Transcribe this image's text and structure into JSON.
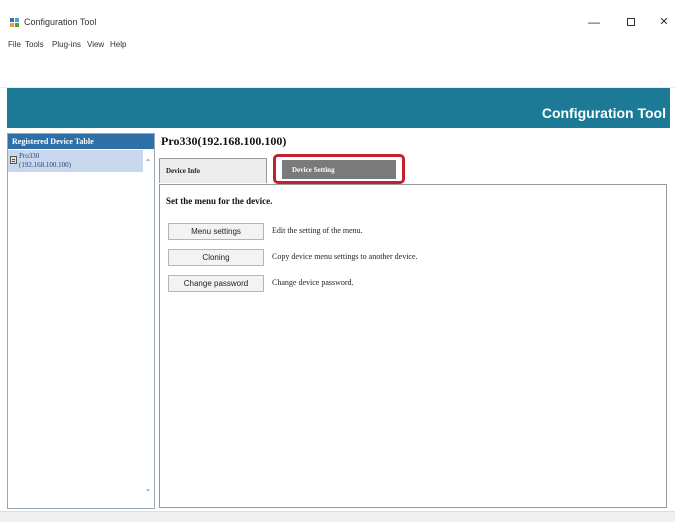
{
  "window": {
    "title": "Configuration Tool",
    "minimize_icon": "minimize-icon",
    "maximize_icon": "maximize-icon",
    "close_icon": "close-icon",
    "close_glyph": "✕",
    "minimize_glyph": "—"
  },
  "menubar": {
    "items": [
      "File",
      "Tools",
      "Plug-ins",
      "View",
      "Help"
    ]
  },
  "banner": {
    "title": "Configuration Tool",
    "color": "#1d7a96"
  },
  "sidebar": {
    "header": "Registered Device Table",
    "device": {
      "name": "Pro330",
      "ip": "(192.168.100.100)"
    },
    "scroll_up_glyph": "⌃",
    "scroll_down_glyph": "⌄"
  },
  "main": {
    "device_title": "Pro330(192.168.100.100)",
    "tabs": [
      {
        "label": "Device Info",
        "active": false
      },
      {
        "label": "Device Setting",
        "active": true,
        "highlighted": true
      }
    ],
    "section_heading": "Set the menu for the device.",
    "actions": [
      {
        "button": "Menu settings",
        "description": "Edit the setting of the menu."
      },
      {
        "button": "Cloning",
        "description": "Copy device menu settings to another device."
      },
      {
        "button": "Change password",
        "description": "Change device password."
      }
    ]
  },
  "colors": {
    "highlight": "#c41f2c",
    "sidebar_header": "#2f6fa8",
    "selected_node": "#c9d7ec"
  }
}
